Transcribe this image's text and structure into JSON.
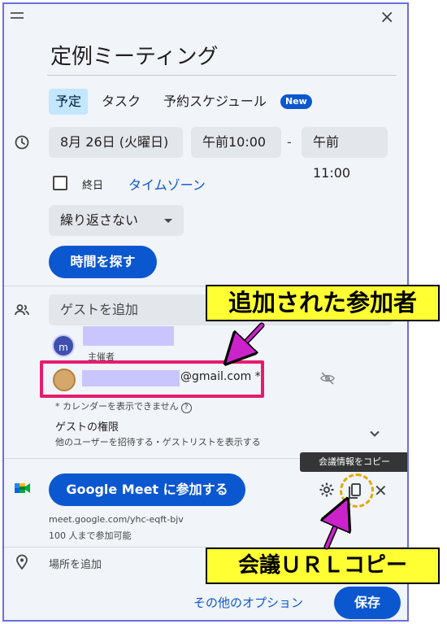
{
  "dialog": {
    "title": "定例ミーティング",
    "tabs": [
      {
        "label": "予定"
      },
      {
        "label": "タスク"
      },
      {
        "label": "予約スケジュール"
      }
    ],
    "new_badge": "New"
  },
  "datetime": {
    "date": "8月 26日 (火曜日)",
    "start": "午前10:00",
    "separator": "-",
    "end": "午前11:00",
    "allday_label": "終日",
    "timezone_label": "タイムゾーン",
    "repeat_value": "繰り返さない",
    "find_time_label": "時間を探す"
  },
  "guests": {
    "placeholder": "ゲストを追加",
    "organizer": {
      "avatar_letter": "m",
      "role": "主催者"
    },
    "added_guest": {
      "email_suffix": "@gmail.com *"
    },
    "calendar_note": "* カレンダーを表示できません",
    "help_icon": "?",
    "permissions_title": "ゲストの権限",
    "permissions_desc": "他のユーザーを招待する・ゲストリストを表示する"
  },
  "meet": {
    "join_label": "Google Meet に参加する",
    "link": "meet.google.com/yhc-eqft-bjv",
    "limit": "100 人まで参加可能",
    "tooltip": "会議情報をコピー"
  },
  "location": {
    "placeholder": "場所を追加"
  },
  "footer": {
    "more_options": "その他のオプション",
    "save": "保存"
  },
  "annotations": {
    "guests_callout": "追加された参加者",
    "copy_callout": "会議ＵＲＬコピー"
  },
  "icons": {
    "close": "×",
    "remove": "✕"
  },
  "colors": {
    "primary": "#0b57d0",
    "tab_active": "#c2e7ff",
    "highlight_box": "#e61b6e",
    "callout_bg": "#ffff33",
    "arrow": "#cc22cc"
  }
}
